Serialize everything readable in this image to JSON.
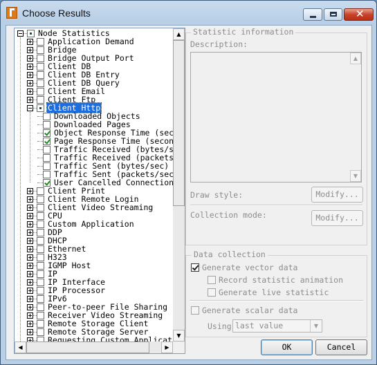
{
  "window": {
    "title": "Choose Results"
  },
  "controls": {
    "minimize_icon": "minimize-icon",
    "maximize_icon": "maximize-icon",
    "close_icon": "close-icon",
    "close_glyph": "✕"
  },
  "tree": {
    "root": "Node Statistics",
    "top_items": [
      "Application Demand",
      "Bridge",
      "Bridge Output Port",
      "Client DB",
      "Client DB Entry",
      "Client DB Query",
      "Client Email",
      "Client Ftp"
    ],
    "selected": "Client Http",
    "children": [
      {
        "label": "Downloaded Objects",
        "checked": false
      },
      {
        "label": "Downloaded Pages",
        "checked": false
      },
      {
        "label": "Object Response Time (seco",
        "checked": true
      },
      {
        "label": "Page Response Time (second",
        "checked": true
      },
      {
        "label": "Traffic Received (bytes/se",
        "checked": false
      },
      {
        "label": "Traffic Received (packets/",
        "checked": false
      },
      {
        "label": "Traffic Sent (bytes/sec)",
        "checked": false
      },
      {
        "label": "Traffic Sent (packets/sec)",
        "checked": false
      },
      {
        "label": "User Cancelled Connections",
        "checked": true
      }
    ],
    "bottom_items": [
      "Client Print",
      "Client Remote Login",
      "Client Video Streaming",
      "CPU",
      "Custom Application",
      "DDP",
      "DHCP",
      "Ethernet",
      "H323",
      "IGMP Host",
      "IP",
      "IP Interface",
      "IP Processor",
      "IPv6",
      "Peer-to-peer File Sharing",
      "Receiver Video Streaming",
      "Remote Storage Client",
      "Remote Storage Server",
      "Requesting Custom Application"
    ]
  },
  "stat_info": {
    "legend": "Statistic information",
    "description_label": "Description:",
    "draw_style_label": "Draw style:",
    "collection_mode_label": "Collection mode:",
    "modify_label": "Modify..."
  },
  "data_collection": {
    "legend": "Data collection",
    "vector": {
      "label": "Generate vector data",
      "checked": true
    },
    "animation": {
      "label": "Record statistic animation",
      "checked": false
    },
    "live": {
      "label": "Generate live statistic",
      "checked": false
    },
    "scalar": {
      "label": "Generate scalar data",
      "checked": false
    },
    "using_label": "Using",
    "using_value": "last value"
  },
  "buttons": {
    "ok": "OK",
    "cancel": "Cancel"
  },
  "scroll_glyphs": {
    "up": "▲",
    "down": "▼",
    "left": "◀",
    "right": "▶"
  }
}
